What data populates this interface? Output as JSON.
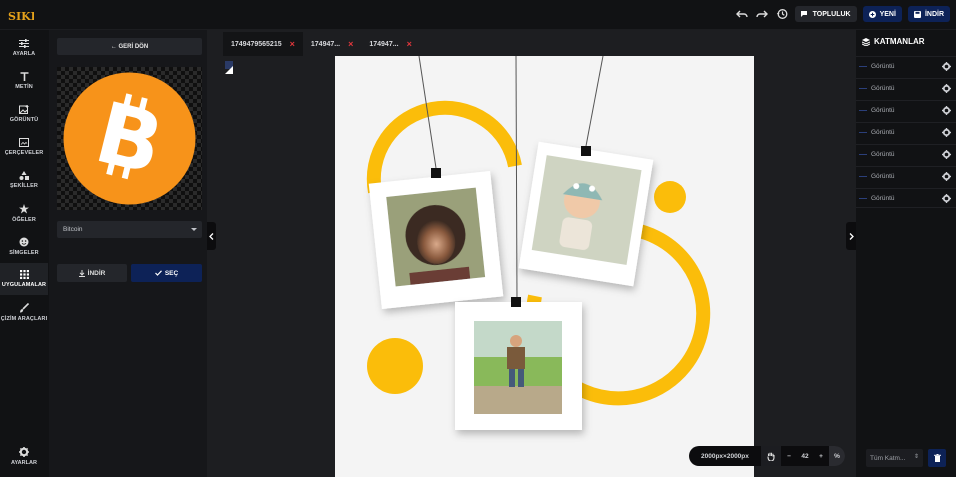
{
  "topbar": {
    "logo_text": "SIKKA",
    "buttons": {
      "community": "TOPLULUK",
      "new": "YENİ",
      "download": "İNDİR"
    }
  },
  "nav": {
    "items": [
      {
        "label": "AYARLA",
        "icon": "sliders-icon"
      },
      {
        "label": "METİN",
        "icon": "text-icon"
      },
      {
        "label": "GÖRÜNTÜ",
        "icon": "image-icon"
      },
      {
        "label": "ÇERÇEVELER",
        "icon": "frame-icon"
      },
      {
        "label": "ŞEKİLLER",
        "icon": "shapes-icon"
      },
      {
        "label": "ÖĞELER",
        "icon": "star-icon"
      },
      {
        "label": "SİMGELER",
        "icon": "emoji-icon"
      },
      {
        "label": "UYGULAMALAR",
        "icon": "apps-grid-icon",
        "active": true
      },
      {
        "label": "ÇİZİM ARAÇLARI",
        "icon": "brush-icon"
      }
    ],
    "settings_label": "AYARLAR"
  },
  "panel": {
    "back_label": "GERİ DÖN",
    "select_value": "Bitcoin",
    "download_label": "İNDİR",
    "select_label": "SEÇ"
  },
  "tabs": [
    {
      "label": "1749479565215",
      "active": true
    },
    {
      "label": "174947...",
      "active": false
    },
    {
      "label": "174947...",
      "active": false
    }
  ],
  "zoom": {
    "size_label": "2000px×2000px",
    "value": "42",
    "minus": "−",
    "plus": "+",
    "percent": "%"
  },
  "layers": {
    "title": "KATMANLAR",
    "items": [
      "Görüntü",
      "Görüntü",
      "Görüntü",
      "Görüntü",
      "Görüntü",
      "Görüntü",
      "Görüntü"
    ],
    "filter_value": "Tüm Katm..."
  },
  "colors": {
    "accent_blue": "#0d2257",
    "close_red": "#e0373c",
    "bitcoin_orange": "#f7931a",
    "canvas_yellow": "#fbbd0a"
  }
}
